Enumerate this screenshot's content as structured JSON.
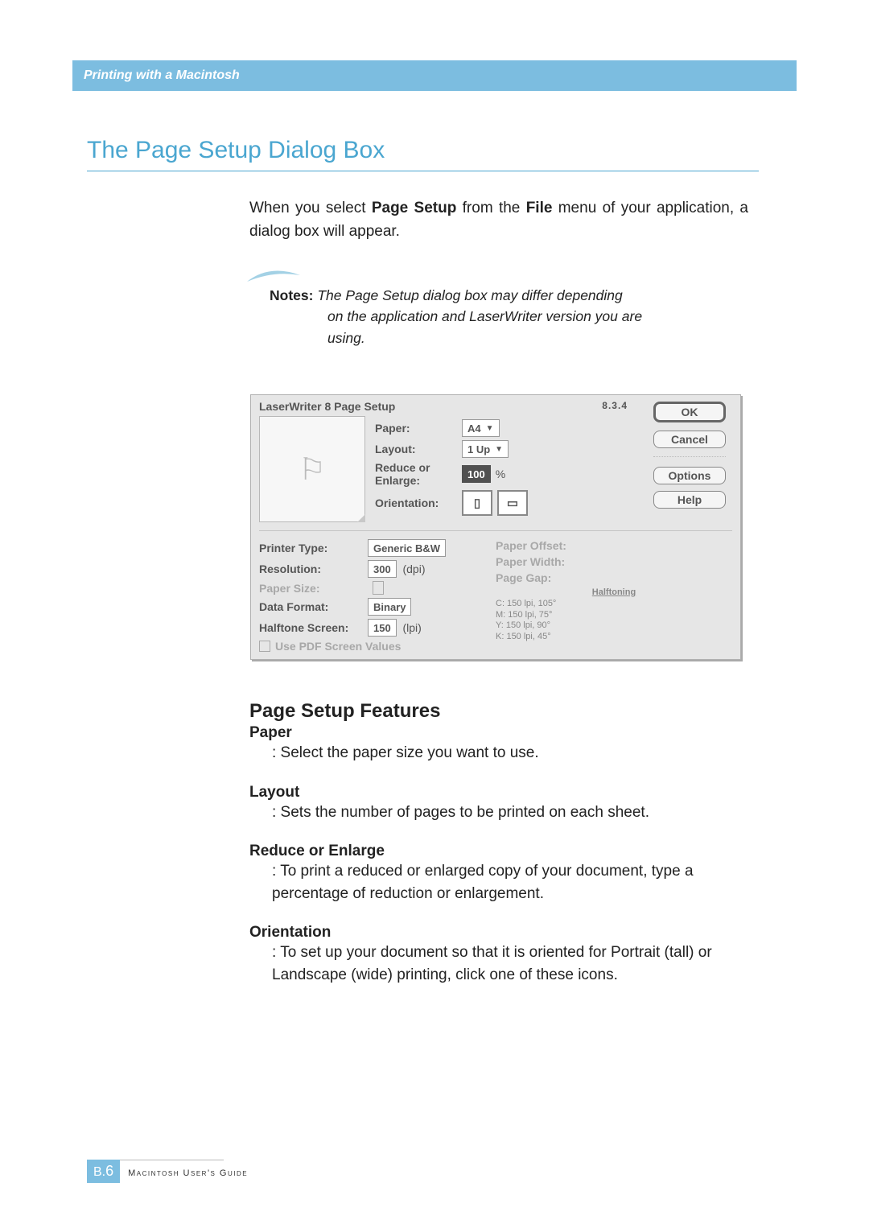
{
  "header": {
    "breadcrumb": "Printing with a Macintosh"
  },
  "title": "The Page Setup Dialog Box",
  "intro": {
    "prefix": "When you select ",
    "bold1": "Page Setup",
    "mid": " from the ",
    "bold2": "File",
    "suffix": " menu of your application, a dialog box will appear."
  },
  "notes": {
    "label": "Notes:",
    "line1": " The Page Setup dialog box may differ depending",
    "line2": "on the application and LaserWriter version you are",
    "line3": "using."
  },
  "dialog": {
    "title": "LaserWriter 8 Page Setup",
    "version": "8.3.4",
    "buttons": {
      "ok": "OK",
      "cancel": "Cancel",
      "options": "Options",
      "help": "Help"
    },
    "fields": {
      "paper_label": "Paper:",
      "paper_value": "A4",
      "layout_label": "Layout:",
      "layout_value": "1 Up",
      "reduce_label1": "Reduce or",
      "reduce_label2": "Enlarge:",
      "reduce_value": "100",
      "percent": "%",
      "orientation_label": "Orientation:"
    },
    "lower": {
      "printer_type_label": "Printer Type:",
      "printer_type_value": "Generic B&W",
      "resolution_label": "Resolution:",
      "resolution_value": "300",
      "resolution_unit": "(dpi)",
      "paper_size_label": "Paper Size:",
      "data_format_label": "Data Format:",
      "data_format_value": "Binary",
      "halftone_label": "Halftone Screen:",
      "halftone_value": "150",
      "halftone_unit": "(lpi)",
      "use_pdf": "Use PDF Screen Values",
      "paper_offset": "Paper Offset:",
      "paper_width": "Paper Width:",
      "page_gap": "Page Gap:",
      "halftoning_title": "Halftoning",
      "ht_c": "C: 150 lpi, 105°",
      "ht_m": "M: 150 lpi, 75°",
      "ht_y": "Y: 150 lpi, 90°",
      "ht_k": "K: 150 lpi, 45°"
    }
  },
  "features": {
    "heading": "Page Setup Features",
    "items": [
      {
        "label": "Paper",
        "desc": ": Select the paper size you want to use."
      },
      {
        "label": "Layout",
        "desc": ": Sets the number of pages to be printed on each sheet."
      },
      {
        "label": "Reduce or Enlarge",
        "desc": ": To print a reduced or enlarged copy of your document, type a percentage of reduction or enlargement."
      },
      {
        "label": "Orientation",
        "desc": ": To set up your document so that it is oriented for Portrait (tall) or Landscape (wide) printing, click one of these icons."
      }
    ]
  },
  "footer": {
    "page_prefix": "B.",
    "page_num": "6",
    "caption": "Macintosh User's Guide"
  }
}
